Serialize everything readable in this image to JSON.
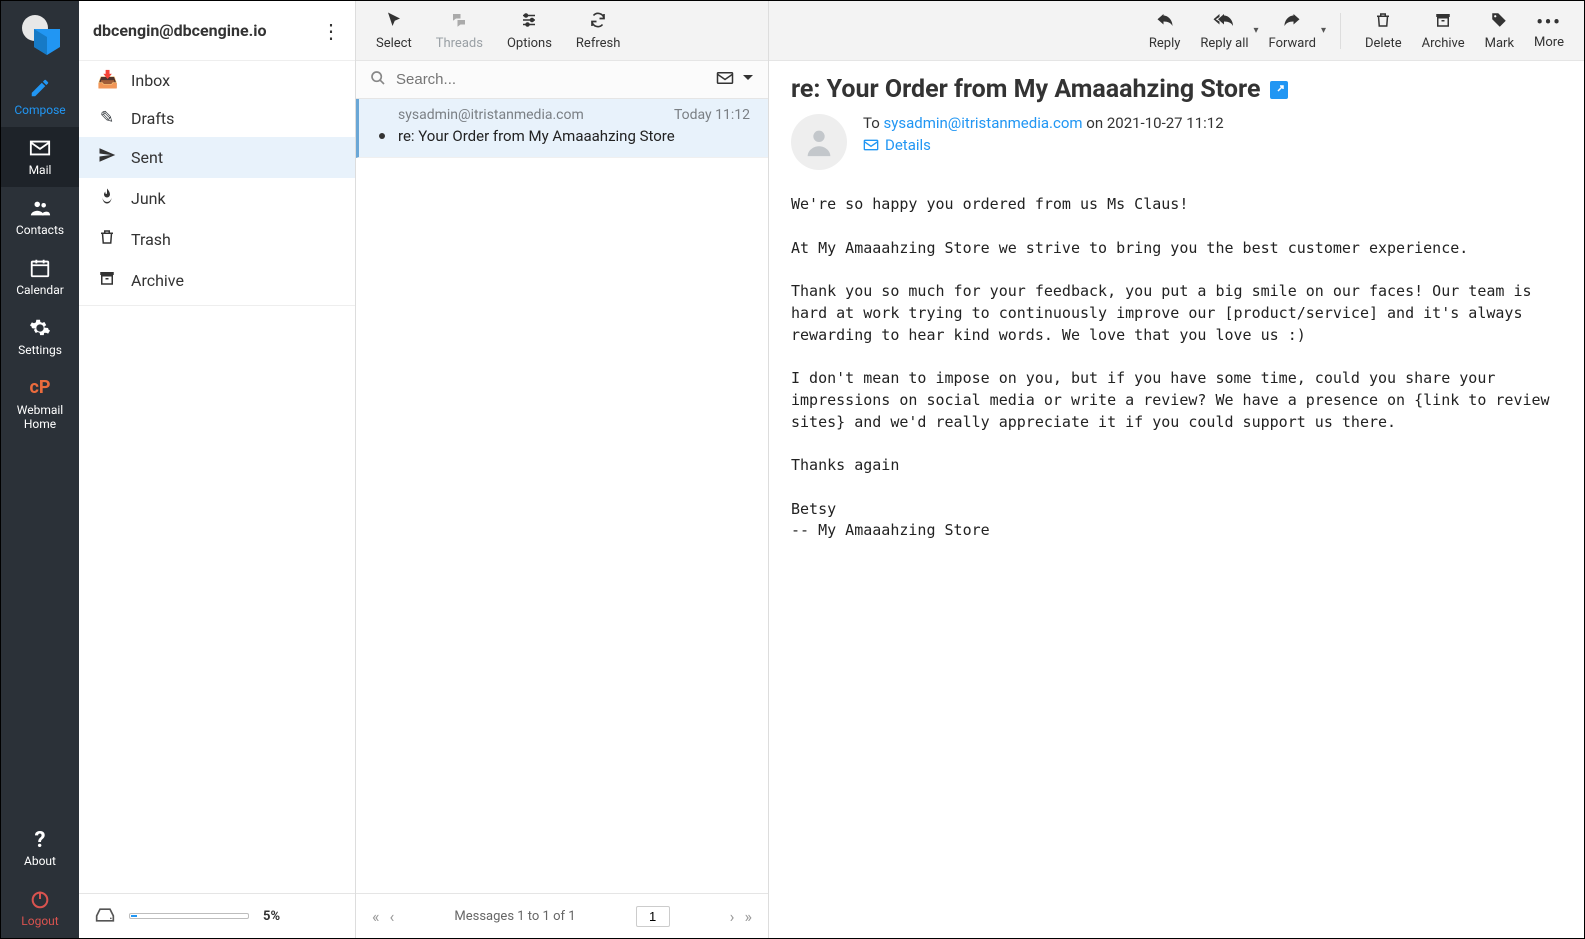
{
  "account": {
    "email": "dbcengin@dbcengine.io"
  },
  "leftnav": {
    "compose": "Compose",
    "mail": "Mail",
    "contacts": "Contacts",
    "calendar": "Calendar",
    "settings": "Settings",
    "webmail": "Webmail Home",
    "about": "About",
    "logout": "Logout"
  },
  "folders": [
    {
      "id": "inbox",
      "label": "Inbox"
    },
    {
      "id": "drafts",
      "label": "Drafts"
    },
    {
      "id": "sent",
      "label": "Sent"
    },
    {
      "id": "junk",
      "label": "Junk"
    },
    {
      "id": "trash",
      "label": "Trash"
    },
    {
      "id": "archive",
      "label": "Archive"
    }
  ],
  "quota": {
    "pct": "5%"
  },
  "list_toolbar": {
    "select": "Select",
    "threads": "Threads",
    "options": "Options",
    "refresh": "Refresh"
  },
  "search": {
    "placeholder": "Search..."
  },
  "messages": [
    {
      "from": "sysadmin@itristanmedia.com",
      "date": "Today 11:12",
      "subject": "re: Your Order from My Amaaahzing Store"
    }
  ],
  "pager": {
    "info": "Messages 1 to 1 of 1",
    "page": "1"
  },
  "read_toolbar": {
    "reply": "Reply",
    "reply_all": "Reply all",
    "forward": "Forward",
    "delete": "Delete",
    "archive": "Archive",
    "mark": "Mark",
    "more": "More"
  },
  "reader": {
    "subject": "re: Your Order from My Amaaahzing Store",
    "to_label": "To",
    "to_email": "sysadmin@itristanmedia.com",
    "on_text": "on 2021-10-27 11:12",
    "details": "Details",
    "body": "We're so happy you ordered from us Ms Claus!\n\nAt My Amaaahzing Store we strive to bring you the best customer experience.\n\nThank you so much for your feedback, you put a big smile on our faces! Our team is hard at work trying to continuously improve our [product/service] and it's always rewarding to hear kind words. We love that you love us :)\n\nI don't mean to impose on you, but if you have some time, could you share your impressions on social media or write a review? We have a presence on {link to review sites} and we'd really appreciate it if you could support us there.\n\nThanks again\n\nBetsy\n-- My Amaaahzing Store"
  }
}
